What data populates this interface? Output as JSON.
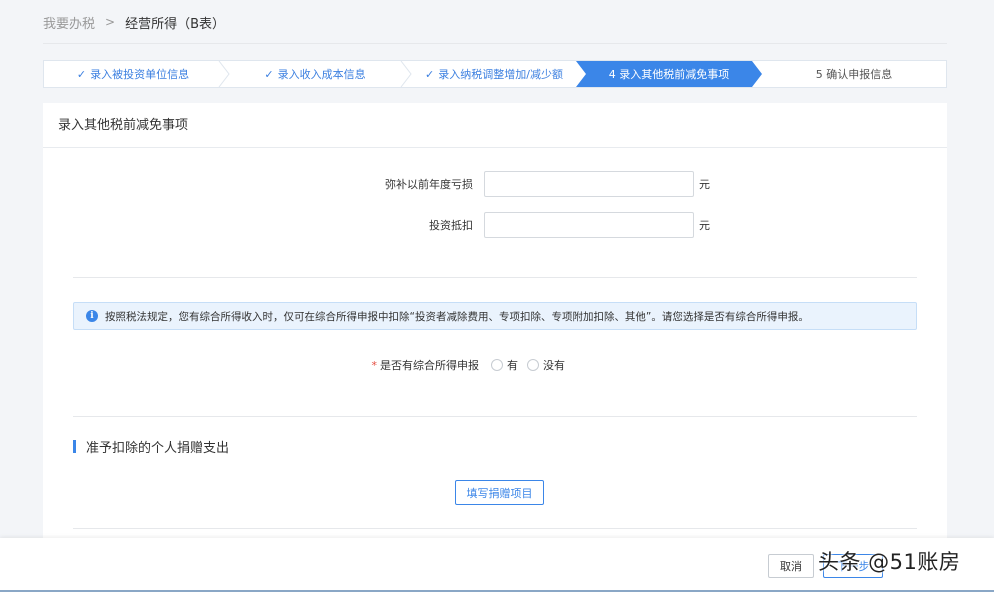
{
  "breadcrumb": {
    "link": "我要办税",
    "separator": ">",
    "current": "经营所得（B表）"
  },
  "steps": [
    {
      "label": "录入被投资单位信息",
      "status": "done"
    },
    {
      "label": "录入收入成本信息",
      "status": "done"
    },
    {
      "label": "录入纳税调整增加/减少额",
      "status": "done"
    },
    {
      "label": "4 录入其他税前减免事项",
      "status": "active"
    },
    {
      "label": "5 确认申报信息",
      "status": "pending"
    }
  ],
  "card": {
    "title": "录入其他税前减免事项",
    "fields": [
      {
        "label": "弥补以前年度亏损",
        "value": "",
        "unit": "元"
      },
      {
        "label": "投资抵扣",
        "value": "",
        "unit": "元"
      }
    ],
    "notice": "按照税法规定，您有综合所得收入时，仅可在综合所得申报中扣除“投资者减除费用、专项扣除、专项附加扣除、其他”。请您选择是否有综合所得申报。",
    "radio": {
      "required_mark": "*",
      "label": "是否有综合所得申报",
      "options": [
        "有",
        "没有"
      ]
    },
    "section_title": "准予扣除的个人捐赠支出",
    "fill_button": "填写捐赠项目"
  },
  "footer": {
    "cancel": "取消",
    "next": "下一步",
    "watermark": "头条 @51账房"
  },
  "colors": {
    "accent": "#3b86e8",
    "required": "#e54d42"
  }
}
